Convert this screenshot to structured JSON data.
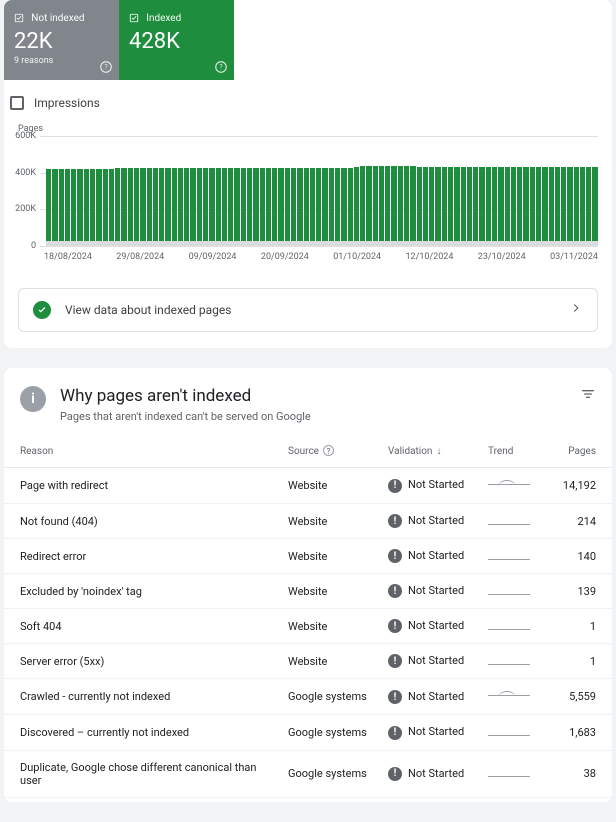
{
  "cards": {
    "notIndexed": {
      "label": "Not indexed",
      "value": "22K",
      "sub": "9 reasons"
    },
    "indexed": {
      "label": "Indexed",
      "value": "428K"
    }
  },
  "impressions_label": "Impressions",
  "chart_data": {
    "type": "bar",
    "ylabel": "Pages",
    "ylim": [
      0,
      600000
    ],
    "y_ticks": [
      "0",
      "200K",
      "400K",
      "600K"
    ],
    "x_ticks": [
      "18/08/2024",
      "29/08/2024",
      "09/09/2024",
      "20/09/2024",
      "01/10/2024",
      "12/10/2024",
      "23/10/2024",
      "03/11/2024"
    ],
    "series": [
      {
        "name": "Indexed",
        "values": [
          420000,
          420000,
          420000,
          421000,
          421000,
          421000,
          421000,
          422000,
          422000,
          422000,
          422000,
          423000,
          423000,
          423000,
          423000,
          423000,
          424000,
          424000,
          424000,
          424000,
          424000,
          424000,
          425000,
          425000,
          425000,
          425000,
          425000,
          425000,
          425000,
          425000,
          425000,
          425000,
          425000,
          426000,
          426000,
          426000,
          426000,
          426000,
          426000,
          426000,
          426000,
          426000,
          426000,
          426000,
          426000,
          426000,
          426000,
          426000,
          428000,
          430000,
          435000,
          435000,
          434000,
          434000,
          434000,
          434000,
          434000,
          434000,
          434000,
          433000,
          432000,
          432000,
          432000,
          432000,
          432000,
          432000,
          432000,
          432000,
          432000,
          432000,
          432000,
          432000,
          432000,
          432000,
          432000,
          432000,
          432000,
          432000,
          432000,
          432000,
          432000,
          432000,
          432000,
          432000,
          432000,
          432000,
          432000,
          432000
        ]
      },
      {
        "name": "Not indexed",
        "values": [
          22000,
          22000,
          22000,
          22000,
          22000,
          22000,
          22000,
          22000,
          22000,
          22000,
          22000,
          22000,
          22000,
          22000,
          22000,
          22000,
          22000,
          22000,
          22000,
          22000,
          22000,
          22000,
          22000,
          22000,
          22000,
          22000,
          22000,
          22000,
          22000,
          22000,
          22000,
          22000,
          22000,
          22000,
          22000,
          22000,
          22000,
          22000,
          22000,
          22000,
          22000,
          22000,
          22000,
          22000,
          22000,
          22000,
          22000,
          22000,
          22000,
          22000,
          22000,
          22000,
          22000,
          22000,
          22000,
          22000,
          22000,
          22000,
          22000,
          22000,
          22000,
          22000,
          22000,
          22000,
          22000,
          22000,
          22000,
          22000,
          22000,
          22000,
          22000,
          22000,
          22000,
          22000,
          22000,
          22000,
          22000,
          22000,
          22000,
          22000,
          22000,
          22000,
          22000,
          22000,
          22000,
          22000,
          22000,
          22000
        ]
      }
    ]
  },
  "link_row": "View data about indexed pages",
  "section": {
    "title": "Why pages aren't indexed",
    "sub": "Pages that aren't indexed can't be served on Google"
  },
  "table": {
    "headers": {
      "reason": "Reason",
      "source": "Source",
      "validation": "Validation",
      "trend": "Trend",
      "pages": "Pages"
    },
    "validation_label": "Not Started",
    "rows": [
      {
        "reason": "Page with redirect",
        "source": "Website",
        "trend": "bump",
        "pages": "14,192"
      },
      {
        "reason": "Not found (404)",
        "source": "Website",
        "trend": "flat",
        "pages": "214"
      },
      {
        "reason": "Redirect error",
        "source": "Website",
        "trend": "flat",
        "pages": "140"
      },
      {
        "reason": "Excluded by 'noindex' tag",
        "source": "Website",
        "trend": "flat",
        "pages": "139"
      },
      {
        "reason": "Soft 404",
        "source": "Website",
        "trend": "flat",
        "pages": "1"
      },
      {
        "reason": "Server error (5xx)",
        "source": "Website",
        "trend": "flat",
        "pages": "1"
      },
      {
        "reason": "Crawled - currently not indexed",
        "source": "Google systems",
        "trend": "bump",
        "pages": "5,559"
      },
      {
        "reason": "Discovered – currently not indexed",
        "source": "Google systems",
        "trend": "flat",
        "pages": "1,683"
      },
      {
        "reason": "Duplicate, Google chose different canonical than user",
        "source": "Google systems",
        "trend": "flat",
        "pages": "38"
      }
    ]
  }
}
